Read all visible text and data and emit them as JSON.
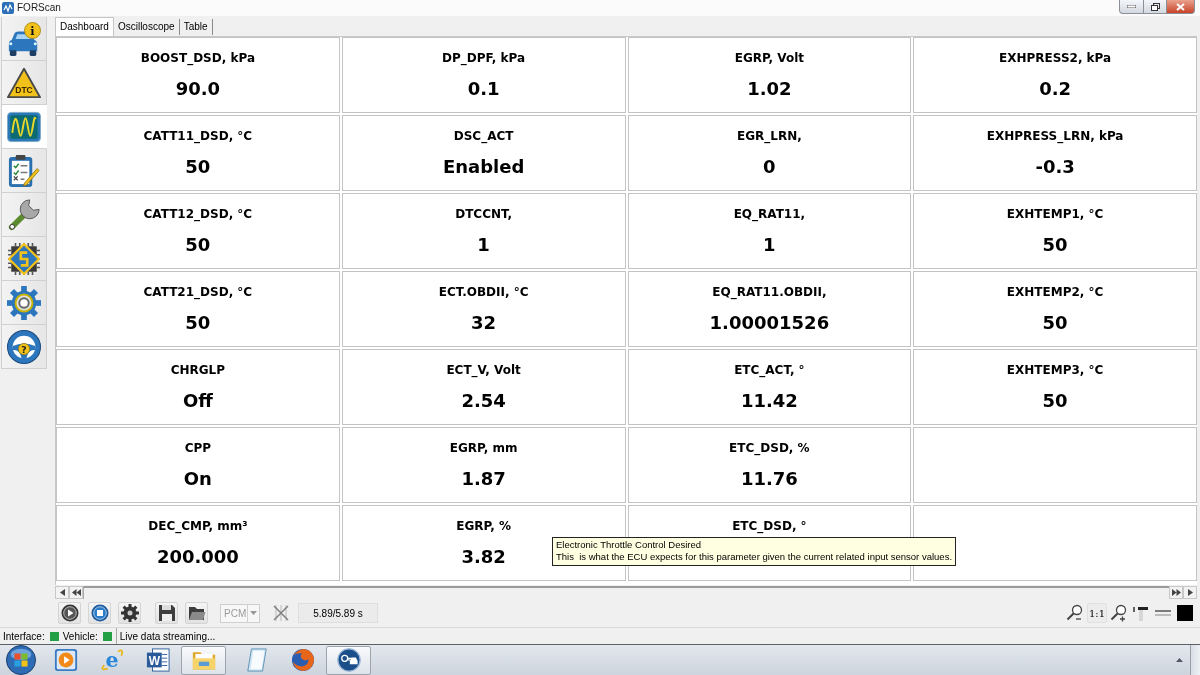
{
  "window": {
    "title": "FORScan"
  },
  "sidebar": {
    "items": [
      {
        "kind": "info",
        "icon_text": "i",
        "selected": false
      },
      {
        "kind": "dtc",
        "icon_text": "DTC",
        "selected": false
      },
      {
        "kind": "scope",
        "selected": true
      },
      {
        "kind": "checklist",
        "selected": false
      },
      {
        "kind": "wrench",
        "selected": false
      },
      {
        "kind": "chip",
        "selected": false
      },
      {
        "kind": "gear",
        "selected": false
      },
      {
        "kind": "wheel",
        "icon_text": "?",
        "selected": false
      }
    ]
  },
  "tabs": [
    {
      "label": "Dashboard",
      "selected": true
    },
    {
      "label": "Oscilloscope",
      "selected": false
    },
    {
      "label": "Table",
      "selected": false
    }
  ],
  "dashboard": {
    "rows": [
      [
        {
          "label": "BOOST_DSD, kPa",
          "value": "90.0"
        },
        {
          "label": "DP_DPF, kPa",
          "value": "0.1"
        },
        {
          "label": "EGRP, Volt",
          "value": "1.02"
        },
        {
          "label": "EXHPRESS2, kPa",
          "value": "0.2"
        }
      ],
      [
        {
          "label": "CATT11_DSD, °C",
          "value": "50"
        },
        {
          "label": "DSC_ACT",
          "value": "Enabled"
        },
        {
          "label": "EGR_LRN,",
          "value": "0"
        },
        {
          "label": "EXHPRESS_LRN, kPa",
          "value": "-0.3"
        }
      ],
      [
        {
          "label": "CATT12_DSD, °C",
          "value": "50"
        },
        {
          "label": "DTCCNT,",
          "value": "1"
        },
        {
          "label": "EQ_RAT11,",
          "value": "1"
        },
        {
          "label": "EXHTEMP1, °C",
          "value": "50"
        }
      ],
      [
        {
          "label": "CATT21_DSD, °C",
          "value": "50"
        },
        {
          "label": "ECT.OBDII, °C",
          "value": "32"
        },
        {
          "label": "EQ_RAT11.OBDII,",
          "value": "1.00001526"
        },
        {
          "label": "EXHTEMP2, °C",
          "value": "50"
        }
      ],
      [
        {
          "label": "CHRGLP",
          "value": "Off"
        },
        {
          "label": "ECT_V, Volt",
          "value": "2.54"
        },
        {
          "label": "ETC_ACT, °",
          "value": "11.42"
        },
        {
          "label": "EXHTEMP3, °C",
          "value": "50"
        }
      ],
      [
        {
          "label": "CPP",
          "value": "On"
        },
        {
          "label": "EGRP, mm",
          "value": "1.87"
        },
        {
          "label": "ETC_DSD, %",
          "value": "11.76"
        }
      ],
      [
        {
          "label": "DEC_CMP, mm³",
          "value": "200.000"
        },
        {
          "label": "EGRP, %",
          "value": "3.82"
        },
        {
          "label": "ETC_DSD, °"
        }
      ]
    ]
  },
  "tooltip": {
    "title": "Electronic Throttle Control Desired",
    "text": "This  is what the ECU expects for this parameter given the current related input sensor values."
  },
  "toolbar": {
    "module_select": {
      "value": "PCM",
      "disabled": true
    },
    "time": "5.89/5.89 s",
    "zoom_reset": "1:1"
  },
  "status_bar": {
    "indicators": [
      {
        "label": "Interface:",
        "color": "#23a046"
      },
      {
        "label": "Vehicle:",
        "color": "#23a046"
      }
    ],
    "message": "Live data streaming..."
  },
  "taskbar": {
    "items": [
      {
        "kind": "player",
        "running": false
      },
      {
        "kind": "ie",
        "icon_text": "e",
        "running": false
      },
      {
        "kind": "word",
        "icon_text": "W",
        "running": false
      },
      {
        "kind": "folder",
        "running": true
      },
      {
        "kind": "notepad",
        "running": false
      },
      {
        "kind": "firefox",
        "running": false
      },
      {
        "kind": "forscan",
        "running": true
      }
    ]
  }
}
